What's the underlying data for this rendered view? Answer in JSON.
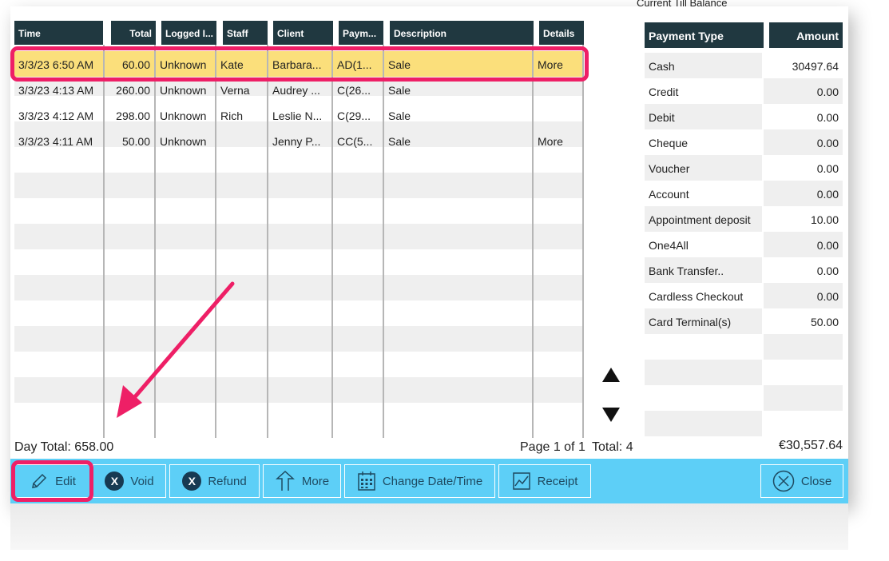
{
  "top_cut_text": "Current Till Balance",
  "transactions": {
    "headers": {
      "time": "Time",
      "total": "Total",
      "logged_in": "Logged I...",
      "staff": "Staff",
      "client": "Client",
      "payment": "Paym...",
      "description": "Description",
      "details": "Details"
    },
    "rows": [
      {
        "time": "3/3/23 6:50 AM",
        "total": "60.00",
        "logged_in": "Unknown",
        "staff": "Kate",
        "client": "Barbara...",
        "payment": "AD(1...",
        "description": "Sale",
        "details": "More"
      },
      {
        "time": "3/3/23 4:13 AM",
        "total": "260.00",
        "logged_in": "Unknown",
        "staff": "Verna",
        "client": "Audrey ...",
        "payment": "C(26...",
        "description": "Sale",
        "details": ""
      },
      {
        "time": "3/3/23 4:12 AM",
        "total": "298.00",
        "logged_in": "Unknown",
        "staff": "Rich",
        "client": "Leslie N...",
        "payment": "C(29...",
        "description": "Sale",
        "details": ""
      },
      {
        "time": "3/3/23 4:11 AM",
        "total": "50.00",
        "logged_in": "Unknown",
        "staff": "",
        "client": "Jenny P...",
        "payment": "CC(5...",
        "description": "Sale",
        "details": "More"
      }
    ],
    "selected_row": 0
  },
  "payments": {
    "headers": {
      "type": "Payment Type",
      "amount": "Amount"
    },
    "rows": [
      {
        "type": "Cash",
        "amount": "30497.64"
      },
      {
        "type": "Credit",
        "amount": "0.00"
      },
      {
        "type": "Debit",
        "amount": "0.00"
      },
      {
        "type": "Cheque",
        "amount": "0.00"
      },
      {
        "type": "Voucher",
        "amount": "0.00"
      },
      {
        "type": "Account",
        "amount": "0.00"
      },
      {
        "type": "Appointment deposit",
        "amount": "10.00"
      },
      {
        "type": "One4All",
        "amount": "0.00"
      },
      {
        "type": "Bank Transfer..",
        "amount": "0.00"
      },
      {
        "type": "Cardless Checkout",
        "amount": "0.00"
      },
      {
        "type": "Card Terminal(s)",
        "amount": "50.00"
      }
    ]
  },
  "footer": {
    "day_total": "Day Total: 658.00",
    "page_info": "Page 1 of 1",
    "total_count": "Total: 4",
    "balance": "€30,557.64"
  },
  "toolbar": {
    "edit": "Edit",
    "void": "Void",
    "refund": "Refund",
    "more": "More",
    "change_date_time": "Change Date/Time",
    "receipt": "Receipt",
    "close": "Close"
  },
  "colors": {
    "header_bg": "#203840",
    "selected_row": "#fbdf7b",
    "toolbar_bg": "#5dcff7",
    "annotation": "#ee1f66"
  }
}
